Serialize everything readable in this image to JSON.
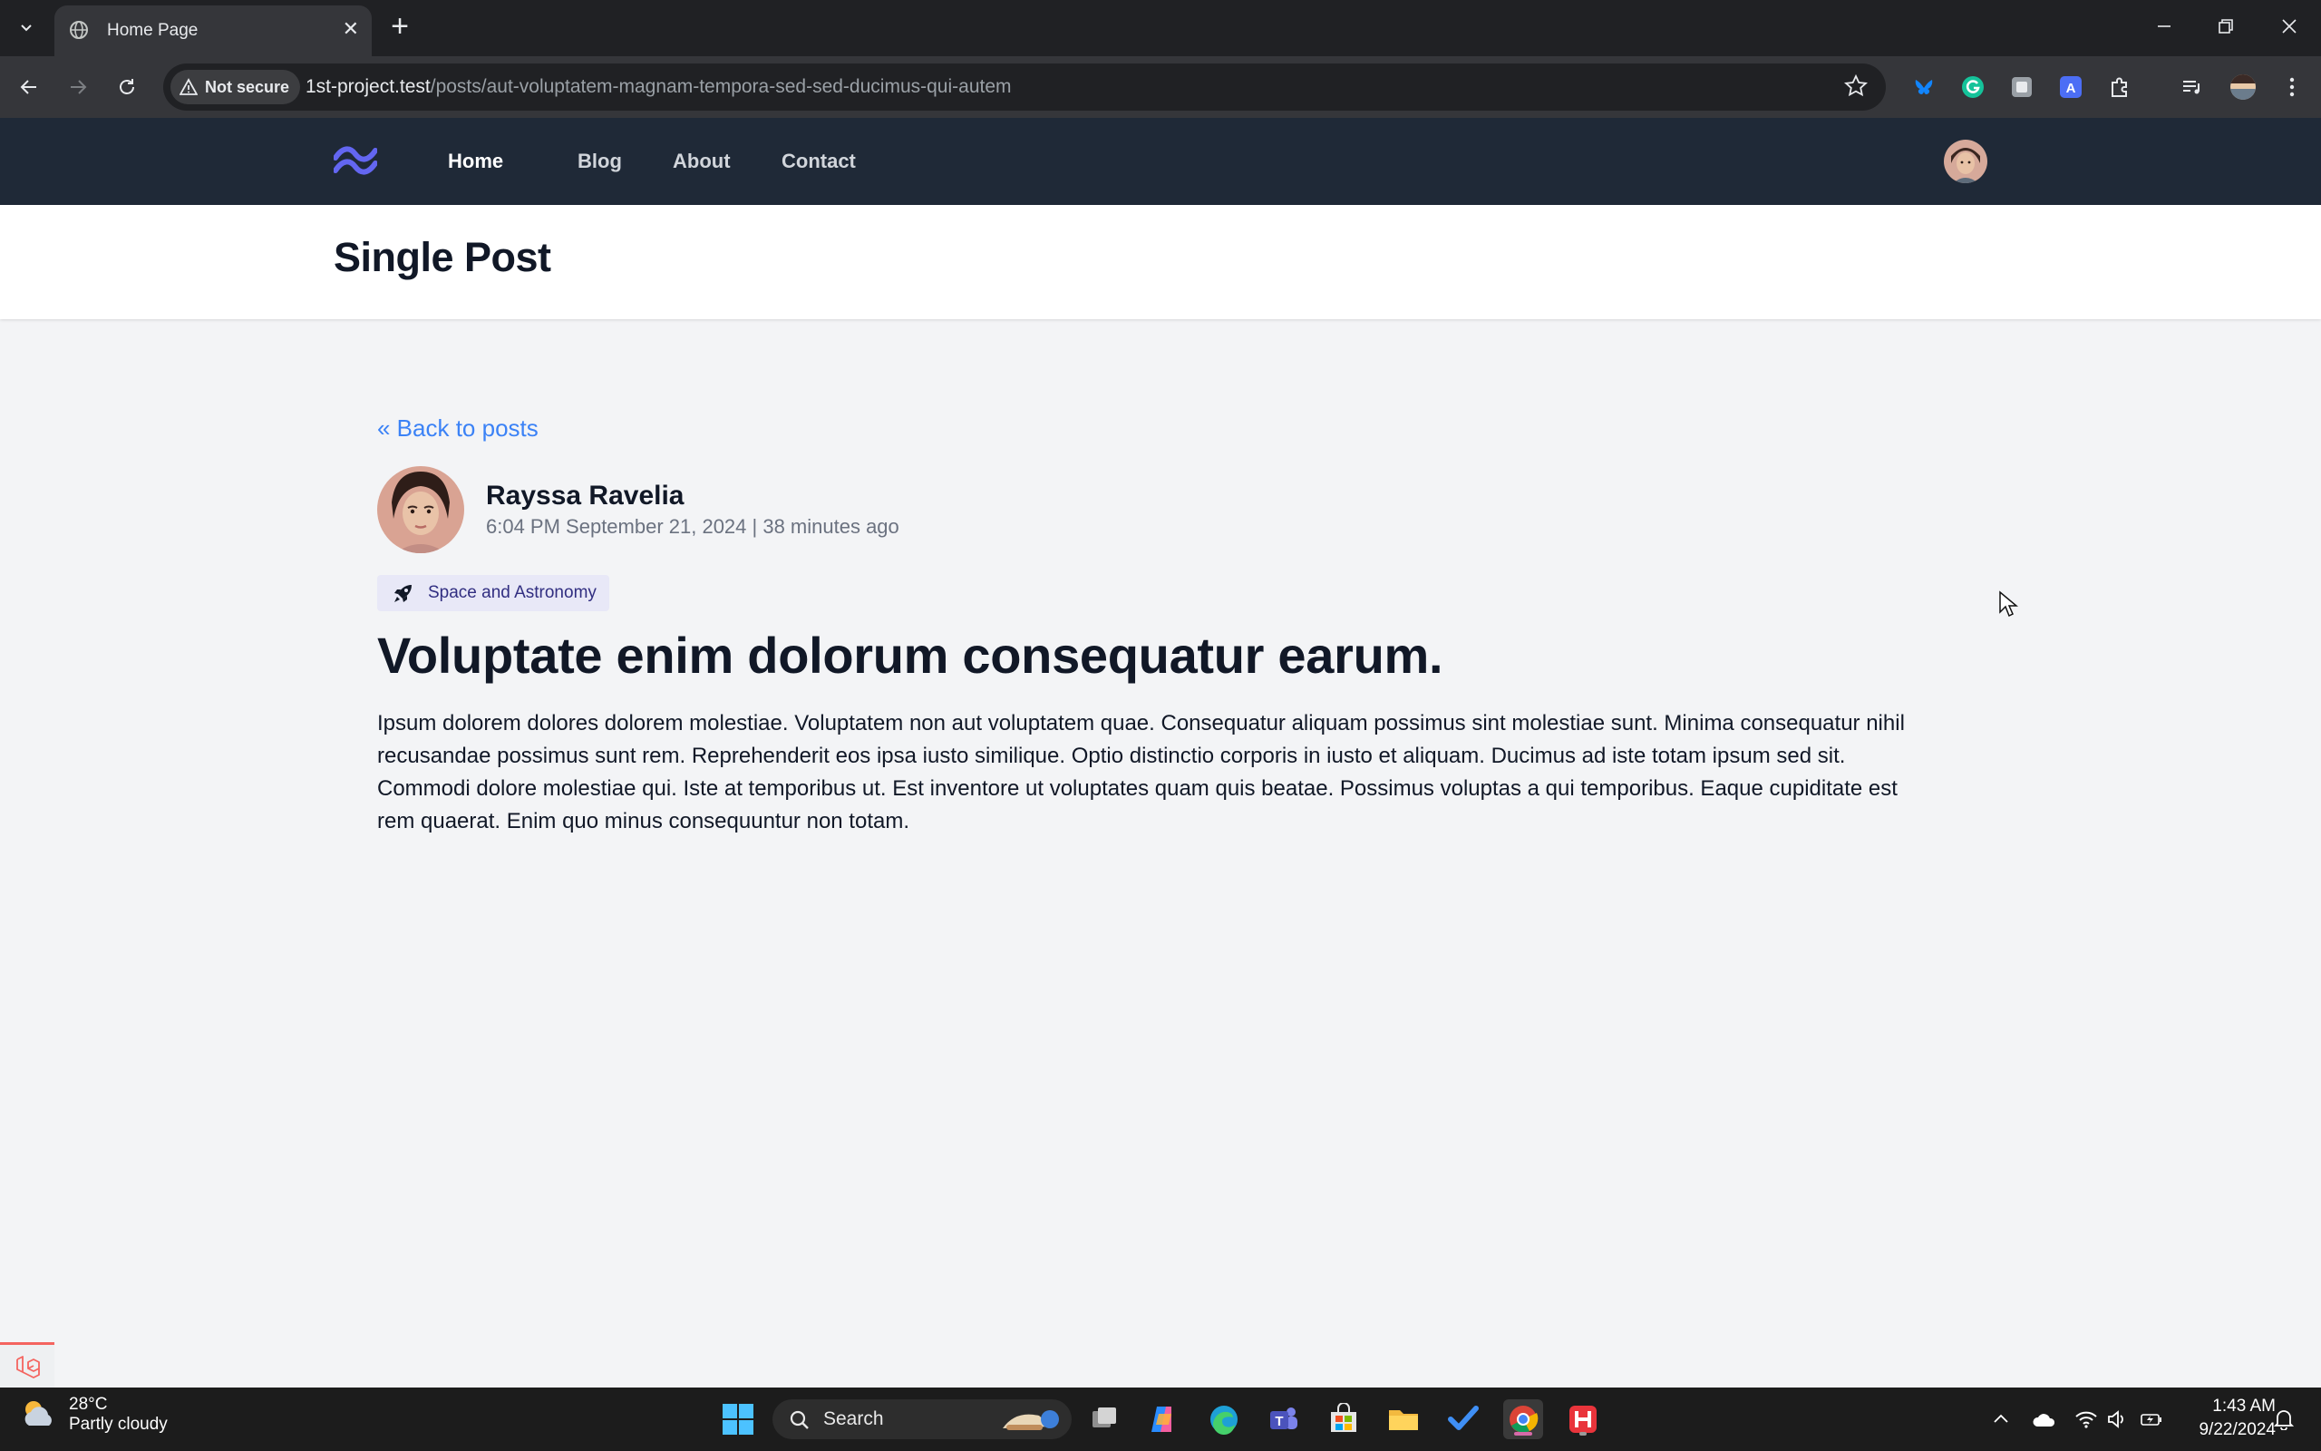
{
  "browser": {
    "tab_title": "Home Page",
    "security_label": "Not secure",
    "url_host": "1st-project.test",
    "url_path": "/posts/aut-voluptatem-magnam-tempora-sed-sed-ducimus-qui-autem",
    "extensions": [
      "bluesky-icon",
      "grammarly-icon",
      "contrast-icon",
      "translate-icon",
      "puzzle-icon"
    ]
  },
  "site": {
    "nav": {
      "items": [
        {
          "label": "Home",
          "active": true
        },
        {
          "label": "Blog",
          "active": false
        },
        {
          "label": "About",
          "active": false
        },
        {
          "label": "Contact",
          "active": false
        }
      ]
    },
    "header_title": "Single Post"
  },
  "post": {
    "back_link": "« Back to posts",
    "author": "Rayssa Ravelia",
    "date_meta": "6:04 PM September 21, 2024 | 38 minutes ago",
    "category": "Space and Astronomy",
    "title": "Voluptate enim dolorum consequatur earum.",
    "body": "Ipsum dolorem dolores dolorem molestiae. Voluptatem non aut voluptatem quae. Consequatur aliquam possimus sint molestiae sunt. Minima consequatur nihil recusandae possimus sunt rem. Reprehenderit eos ipsa iusto similique. Optio distinctio corporis in iusto et aliquam. Ducimus ad iste totam ipsum sed sit. Commodi dolore molestiae qui. Iste at temporibus ut. Est inventore ut voluptates quam quis beatae. Possimus voluptas a qui temporibus. Eaque cupiditate est rem quaerat. Enim quo minus consequuntur non totam."
  },
  "taskbar": {
    "weather_temp": "28°C",
    "weather_condition": "Partly cloudy",
    "search_label": "Search",
    "time": "1:43 AM",
    "date": "9/22/2024"
  },
  "colors": {
    "nav_background": "#1f2937",
    "link_blue": "#3b82f6",
    "category_bg": "#e8e8f7",
    "page_background": "#f3f4f6"
  }
}
